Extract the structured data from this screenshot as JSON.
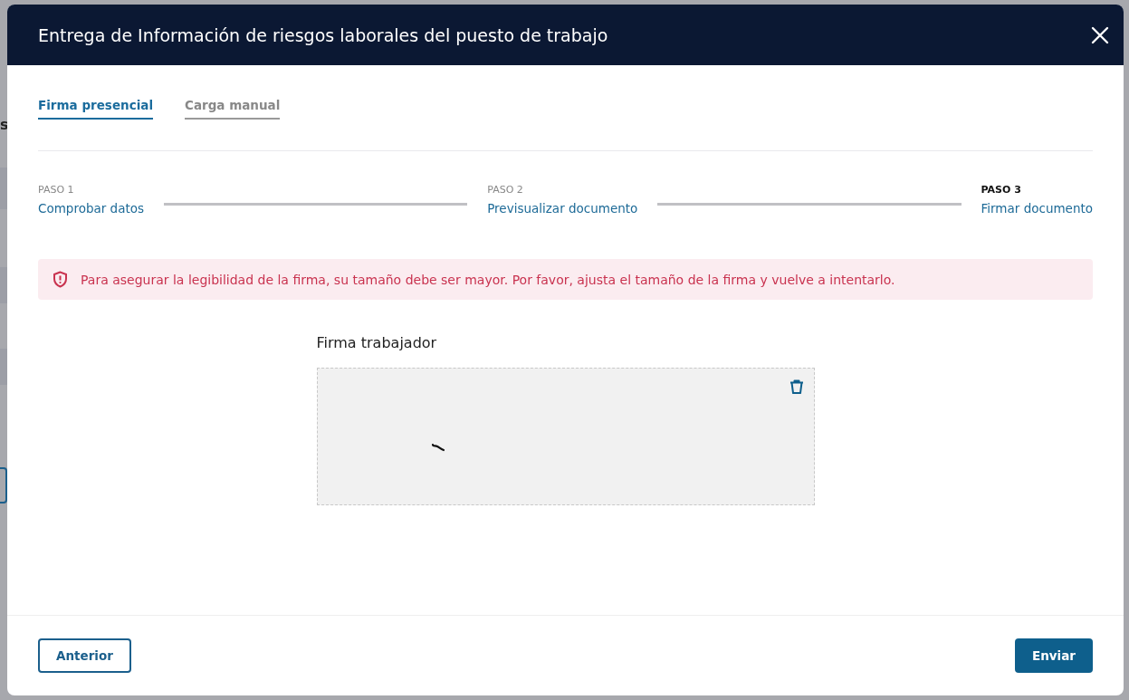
{
  "background_page": {
    "texts": [
      "s"
    ]
  },
  "dialog": {
    "title": "Entrega de Información de riesgos laborales del puesto de trabajo",
    "tabs": [
      {
        "label": "Firma presencial",
        "selected": true
      },
      {
        "label": "Carga manual",
        "selected": false
      }
    ],
    "steps": [
      {
        "label": "PASO 1",
        "title": "Comprobar datos",
        "current": false
      },
      {
        "label": "PASO 2",
        "title": "Previsualizar documento",
        "current": false
      },
      {
        "label": "PASO 3",
        "title": "Firmar documento",
        "current": true
      }
    ],
    "alert": {
      "message": "Para asegurar la legibilidad de la firma, su tamaño debe ser mayor. Por favor, ajusta el tamaño de la firma y vuelve a intentarlo."
    },
    "signature": {
      "label": "Firma trabajador"
    },
    "buttons": [
      {
        "label": "Anterior",
        "kind": "secondary"
      },
      {
        "label": "Enviar",
        "kind": "primary"
      }
    ]
  }
}
